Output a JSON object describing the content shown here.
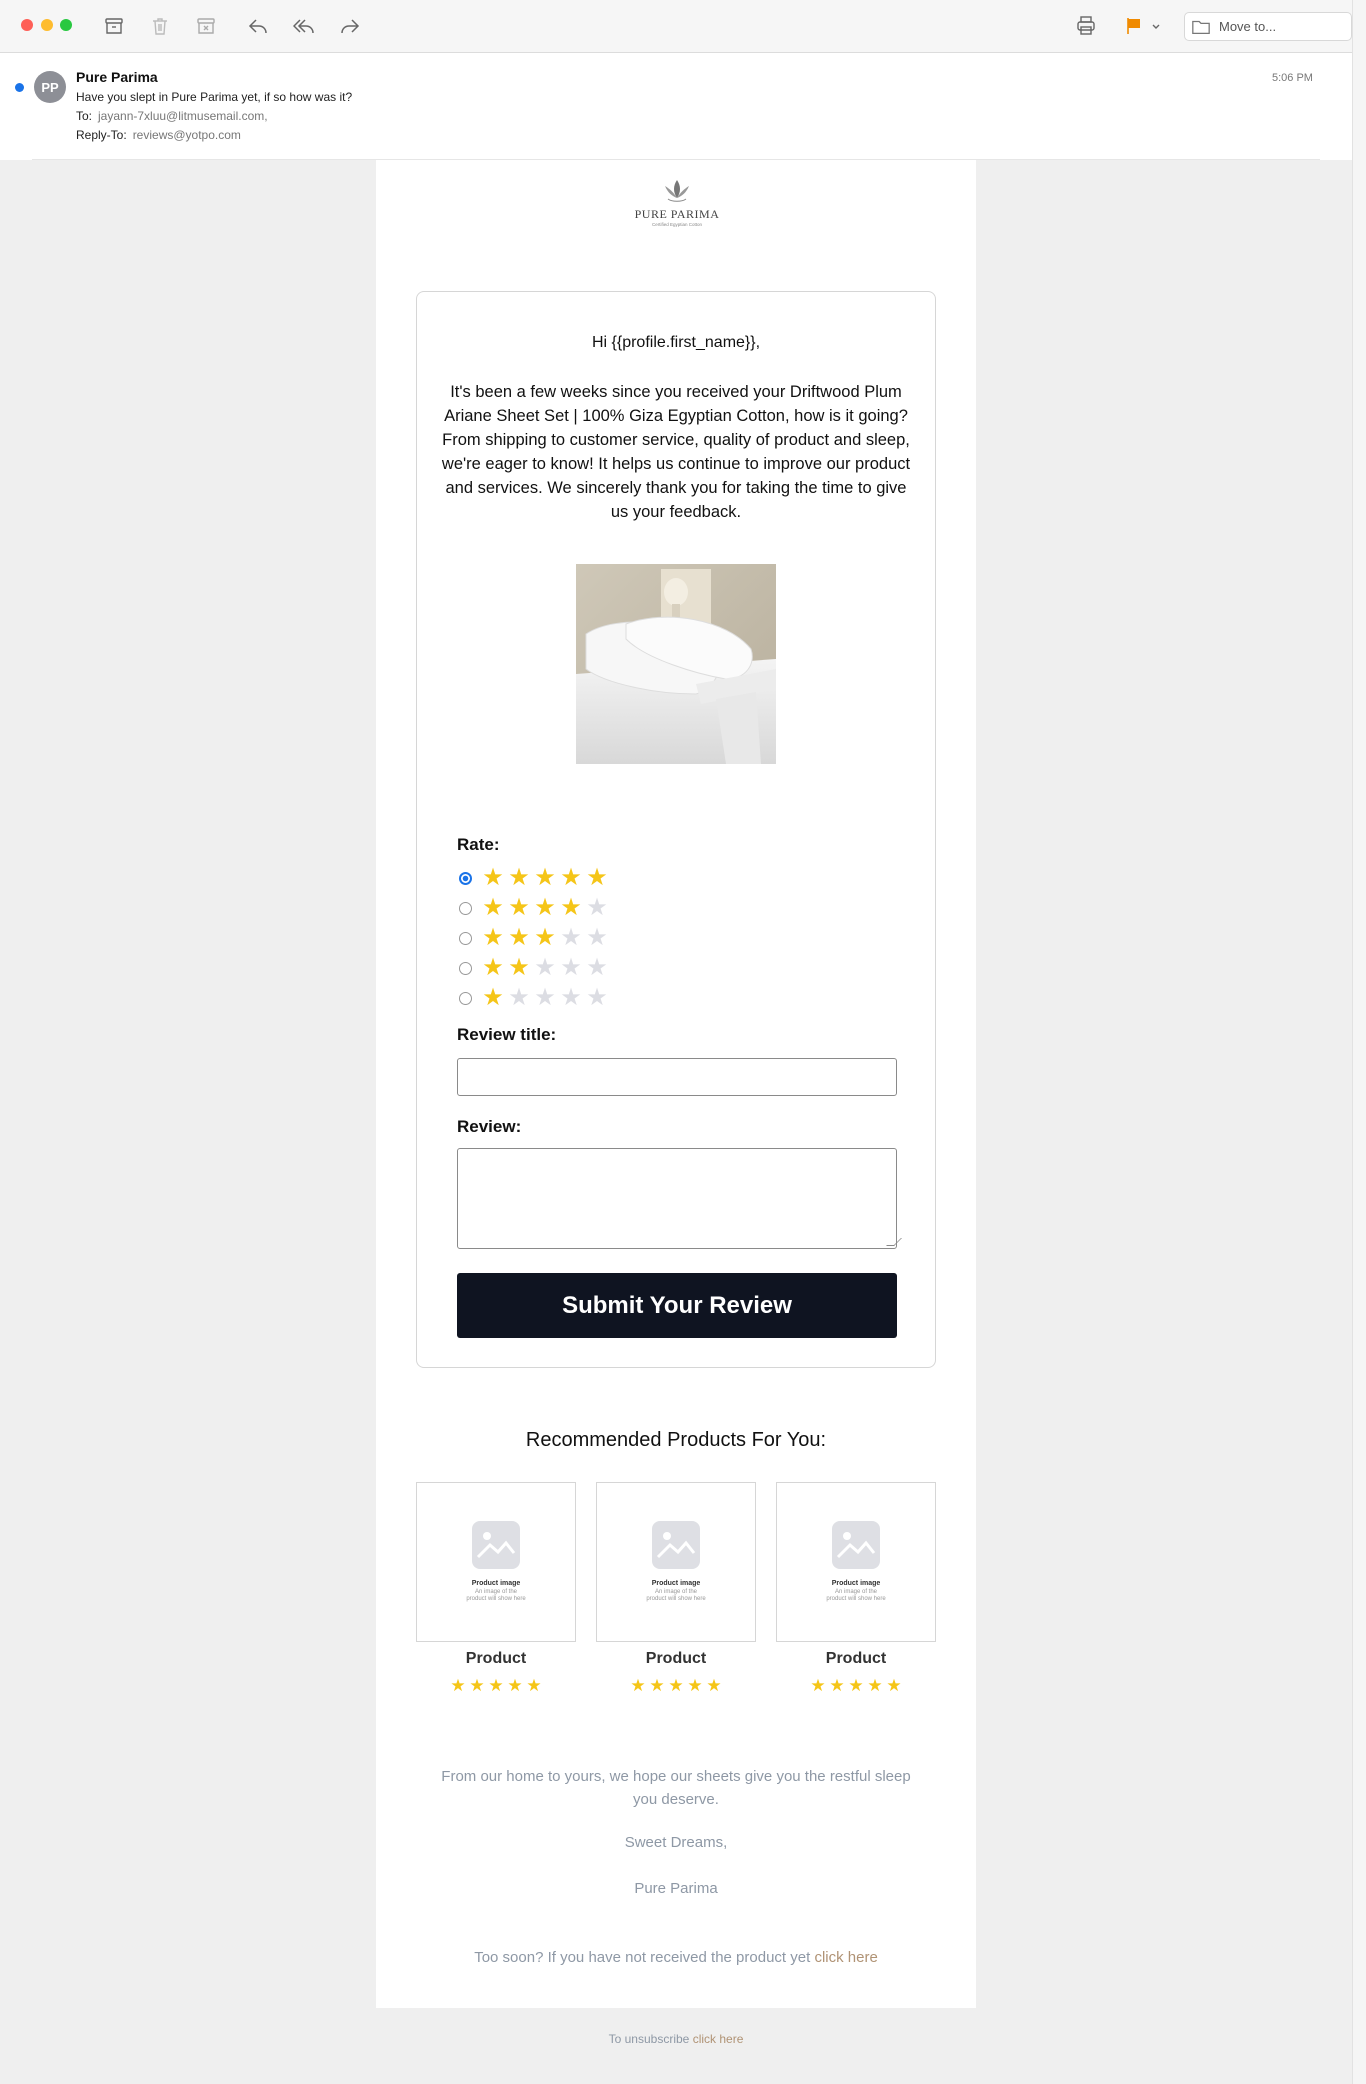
{
  "toolbar": {
    "icons": [
      "archive-icon",
      "trash-icon",
      "junk-icon",
      "reply-icon",
      "reply-all-icon",
      "forward-icon",
      "print-icon",
      "flag-icon",
      "chevron-down-icon",
      "folder-icon"
    ],
    "move_to_label": "Move to...",
    "flag_color": "#f08a00"
  },
  "header": {
    "avatar_initials": "PP",
    "sender": "Pure Parima",
    "subject": "Have you slept in Pure Parima yet, if so how was it?",
    "to_label": "To:",
    "to_value": "jayann-7xluu@litmusemail.com,",
    "reply_to_label": "Reply-To:",
    "reply_to_value": "reviews@yotpo.com",
    "time": "5:06 PM"
  },
  "email": {
    "logo_name": "PURE PARIMA",
    "logo_tagline": "Certified Egyptian Cotton",
    "greeting": "Hi {{profile.first_name}},",
    "body": "It's been a few weeks since you received your Driftwood Plum Ariane Sheet Set | 100% Giza Egyptian Cotton, how is it going? From shipping to customer service, quality of product and sleep, we're eager to know! It helps us continue to improve our product and services. We sincerely thank you for taking the time to give us your feedback.",
    "rate_label": "Rate:",
    "ratings": [
      {
        "stars": 5,
        "selected": true
      },
      {
        "stars": 4,
        "selected": false
      },
      {
        "stars": 3,
        "selected": false
      },
      {
        "stars": 2,
        "selected": false
      },
      {
        "stars": 1,
        "selected": false
      }
    ],
    "review_title_label": "Review title:",
    "review_title_value": "",
    "review_label": "Review:",
    "review_value": "",
    "submit_label": "Submit Your Review",
    "recommended_title": "Recommended Products For You:",
    "products": [
      {
        "placeholder_title": "Product image",
        "placeholder_sub": "An image of the product will show here",
        "name": "Product",
        "rating": 5
      },
      {
        "placeholder_title": "Product image",
        "placeholder_sub": "An image of the product will show here",
        "name": "Product",
        "rating": 5
      },
      {
        "placeholder_title": "Product image",
        "placeholder_sub": "An image of the product will show here",
        "name": "Product",
        "rating": 5
      }
    ],
    "closing": "From our home to yours, we hope our sheets give you the restful sleep you deserve.",
    "sign_off": "Sweet Dreams,",
    "signature": "Pure Parima",
    "too_soon_text": "Too soon? If you have not received the product yet",
    "too_soon_link": "click here",
    "unsubscribe_text": "To unsubscribe",
    "unsubscribe_link": "click here"
  }
}
